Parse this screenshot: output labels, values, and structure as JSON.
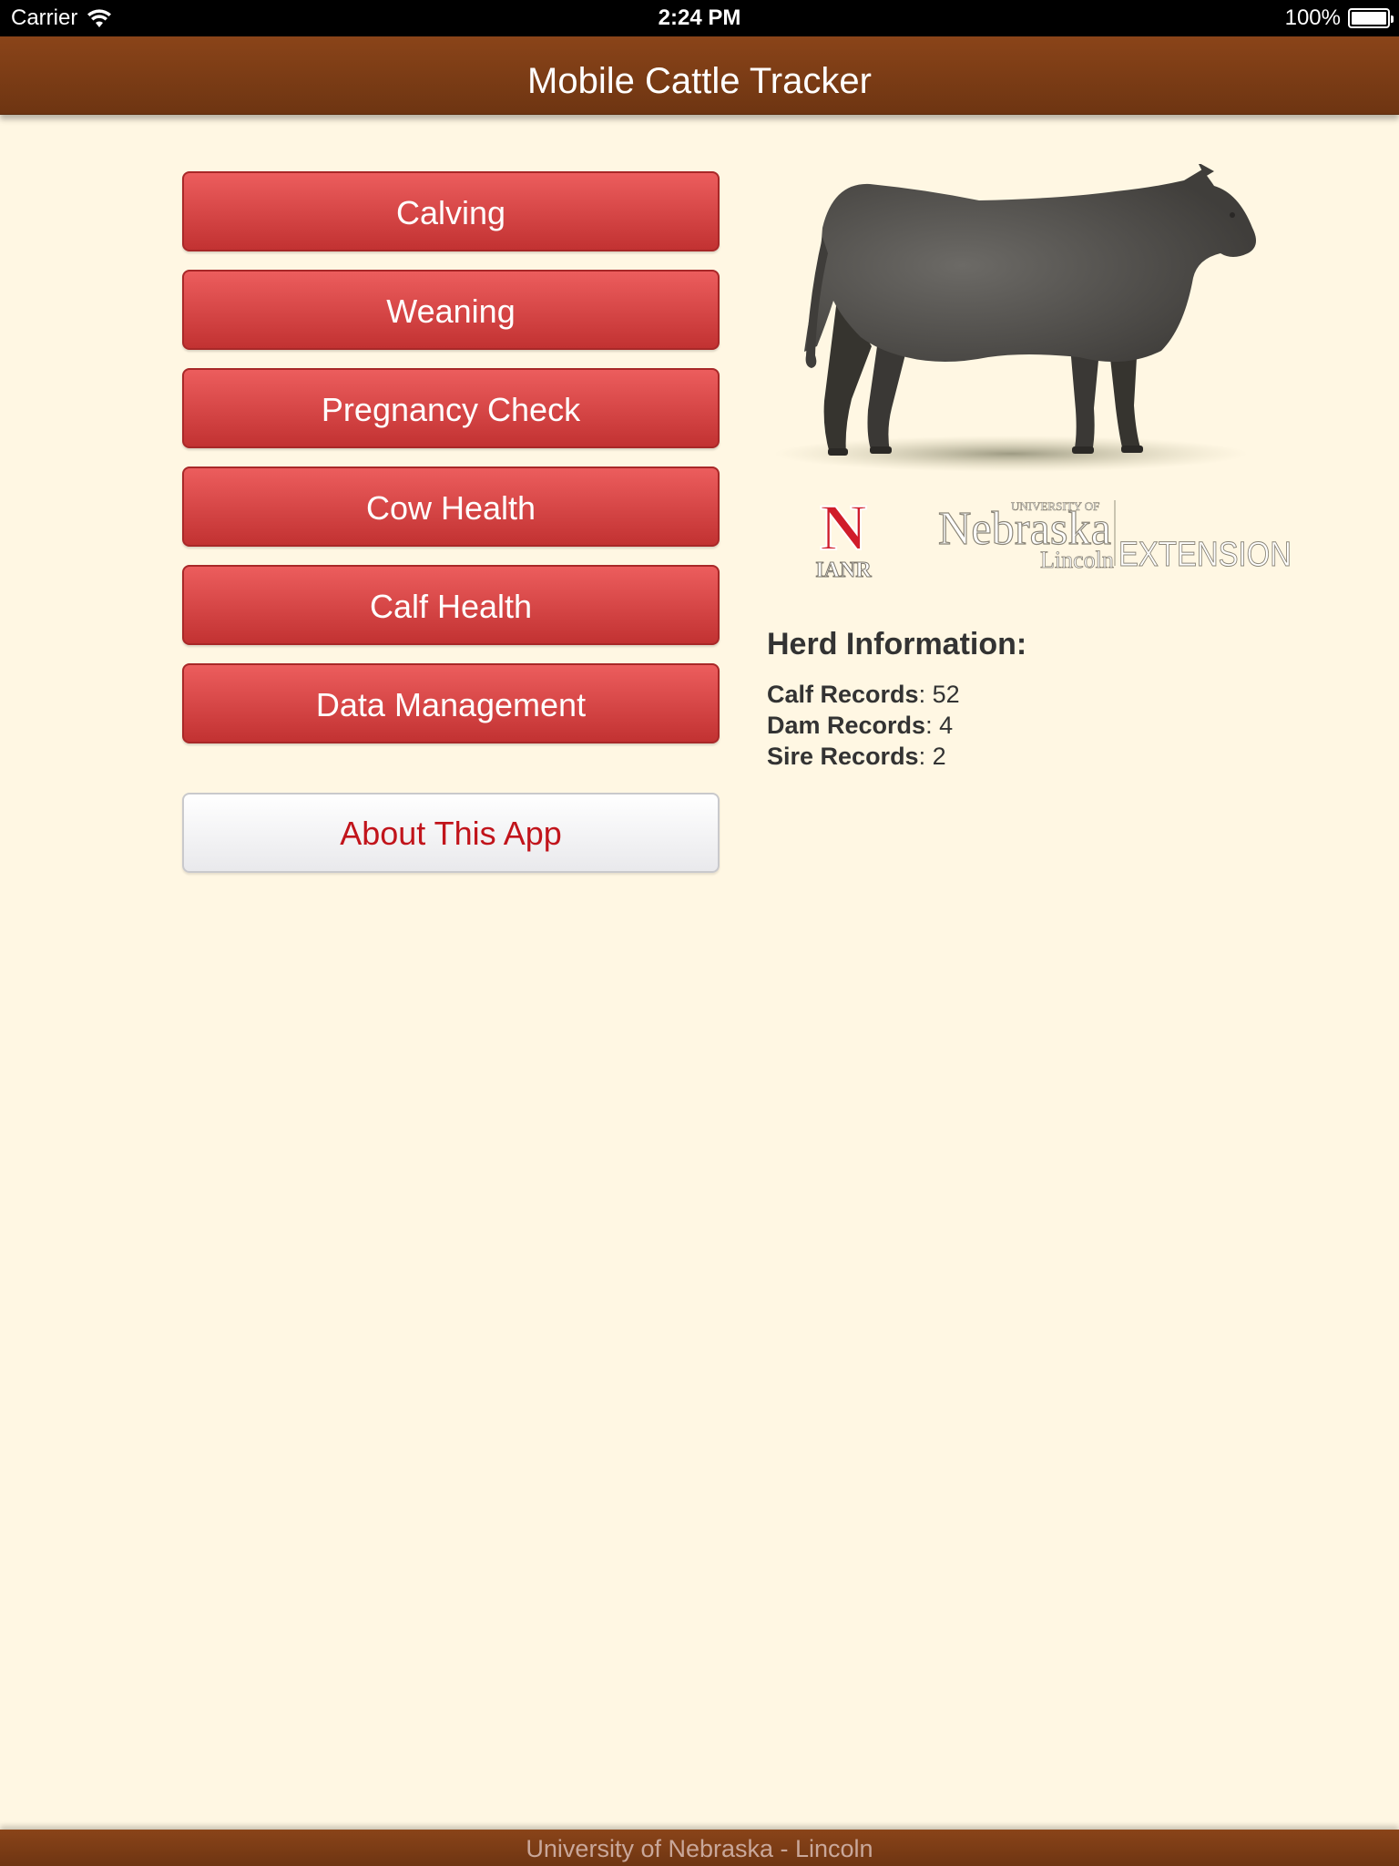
{
  "status_bar": {
    "carrier": "Carrier",
    "time": "2:24 PM",
    "battery": "100%",
    "battery_level": 1.0
  },
  "nav": {
    "title": "Mobile Cattle Tracker"
  },
  "menu": {
    "buttons": [
      {
        "label": "Calving"
      },
      {
        "label": "Weaning"
      },
      {
        "label": "Pregnancy Check"
      },
      {
        "label": "Cow Health"
      },
      {
        "label": "Calf Health"
      },
      {
        "label": "Data Management"
      }
    ],
    "about_label": "About This App"
  },
  "logos": {
    "ianr_letter": "N",
    "ianr_text": "IANR",
    "unl_small": "UNIVERSITY OF",
    "unl_name": "Nebraska",
    "unl_city": "Lincoln",
    "unl_extension": "EXTENSION"
  },
  "herd": {
    "heading": "Herd Information:",
    "rows": [
      {
        "label": "Calf Records",
        "value": ": 52"
      },
      {
        "label": "Dam Records",
        "value": ": 4"
      },
      {
        "label": "Sire Records",
        "value": ": 2"
      }
    ]
  },
  "footer": {
    "text": "University of Nebraska - Lincoln"
  },
  "colors": {
    "background": "#fff7e3",
    "nav_brown": "#7a3c15",
    "button_red": "#d84545",
    "about_text_red": "#c1141b"
  }
}
